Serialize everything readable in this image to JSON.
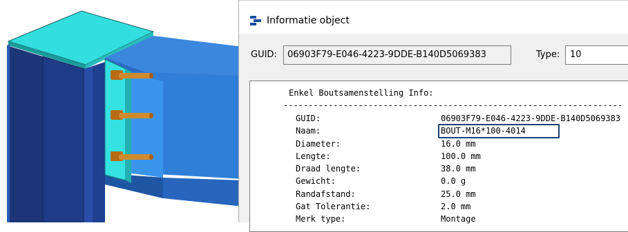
{
  "dialog": {
    "title": "Informatie object",
    "guid_label": "GUID:",
    "guid_value": "06903F79-E046-4223-9DDE-B140D5069383",
    "type_label": "Type:",
    "type_value": "10"
  },
  "report": {
    "heading": "Enkel Boutsamenstelling Info:",
    "separator": "--------------------------------------------------------------------",
    "rows": [
      {
        "label": "GUID:",
        "value": "06903F79-E046-4223-9DDE-B140D5069383"
      },
      {
        "label": "Naam:",
        "value": "BOUT-M16*100-4014"
      },
      {
        "label": "Diameter:",
        "value": "16.0 mm"
      },
      {
        "label": "Lengte:",
        "value": "100.0 mm"
      },
      {
        "label": "Draad lengte:",
        "value": "38.0 mm"
      },
      {
        "label": "Gewicht:",
        "value": "0.0 g"
      },
      {
        "label": "Randafstand:",
        "value": "25.0 mm"
      },
      {
        "label": "Gat Tolerantie:",
        "value": "2.0 mm"
      },
      {
        "label": "Merk type:",
        "value": "Montage"
      }
    ],
    "highlighted_row": "Naam:"
  },
  "colors": {
    "column_blue": "#2a4a9a",
    "beam_blue": "#3a8ee6",
    "plate_cyan": "#33e0e0",
    "bolt_orange": "#c87a1e",
    "highlight_border": "#1f3f73"
  }
}
